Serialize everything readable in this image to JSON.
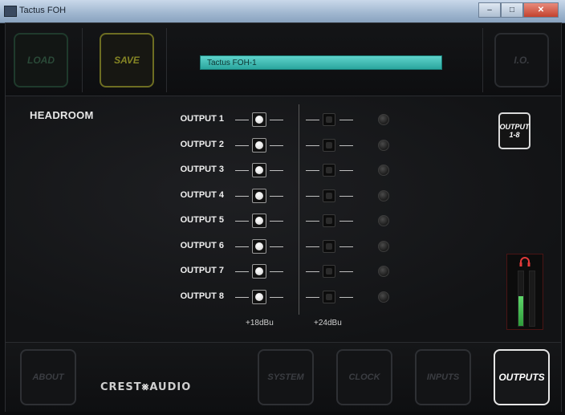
{
  "window": {
    "title": "Tactus FOH"
  },
  "topbar": {
    "load_label": "LOAD",
    "save_label": "SAVE",
    "io_label": "I.O.",
    "device_name": "Tactus FOH-1"
  },
  "main": {
    "title": "HEADROOM",
    "outputs": [
      {
        "label": "OUTPUT 1"
      },
      {
        "label": "OUTPUT 2"
      },
      {
        "label": "OUTPUT 3"
      },
      {
        "label": "OUTPUT 4"
      },
      {
        "label": "OUTPUT 5"
      },
      {
        "label": "OUTPUT 6"
      },
      {
        "label": "OUTPUT 7"
      },
      {
        "label": "OUTPUT 8"
      }
    ],
    "scale_left": "+18dBu",
    "scale_right": "+24dBu",
    "output_group_line1": "OUTPUT",
    "output_group_line2": "1-8",
    "meter_levels": [
      0.55,
      0.0
    ]
  },
  "bottombar": {
    "about_label": "ABOUT",
    "logo_left": "CREST",
    "logo_right": "AUDIO",
    "system_label": "SYSTEM",
    "clock_label": "CLOCK",
    "inputs_label": "INPUTS",
    "outputs_label": "OUTPUTS"
  },
  "colors": {
    "name_field": "#2aa69e",
    "save_border": "#6d6d22",
    "meter_green": "#4fc85a",
    "headphone_red": "#e23a3a"
  }
}
